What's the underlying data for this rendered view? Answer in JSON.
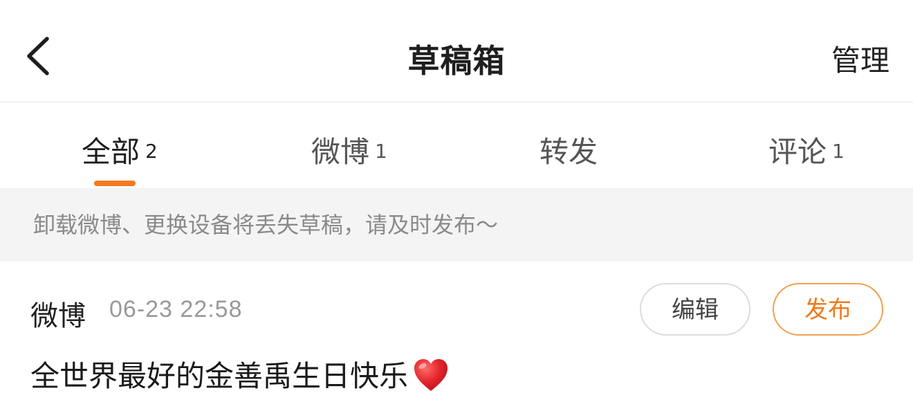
{
  "header": {
    "title": "草稿箱",
    "manage_label": "管理",
    "back_icon": "chevron-left-icon"
  },
  "tabs": [
    {
      "label": "全部",
      "count": "2",
      "active": true
    },
    {
      "label": "微博",
      "count": "1",
      "active": false
    },
    {
      "label": "转发",
      "count": "",
      "active": false
    },
    {
      "label": "评论",
      "count": "1",
      "active": false
    }
  ],
  "notice": {
    "text": "卸载微博、更换设备将丢失草稿，请及时发布～"
  },
  "drafts": [
    {
      "type": "微博",
      "time": "06-23 22:58",
      "edit_label": "编辑",
      "publish_label": "发布",
      "content": "全世界最好的金善禹生日快乐",
      "emoji": "red-heart-icon"
    }
  ],
  "colors": {
    "accent": "#f47a20",
    "notice_bg": "#f4f4f4",
    "muted_text": "#999999",
    "heart": "#e0282e"
  }
}
